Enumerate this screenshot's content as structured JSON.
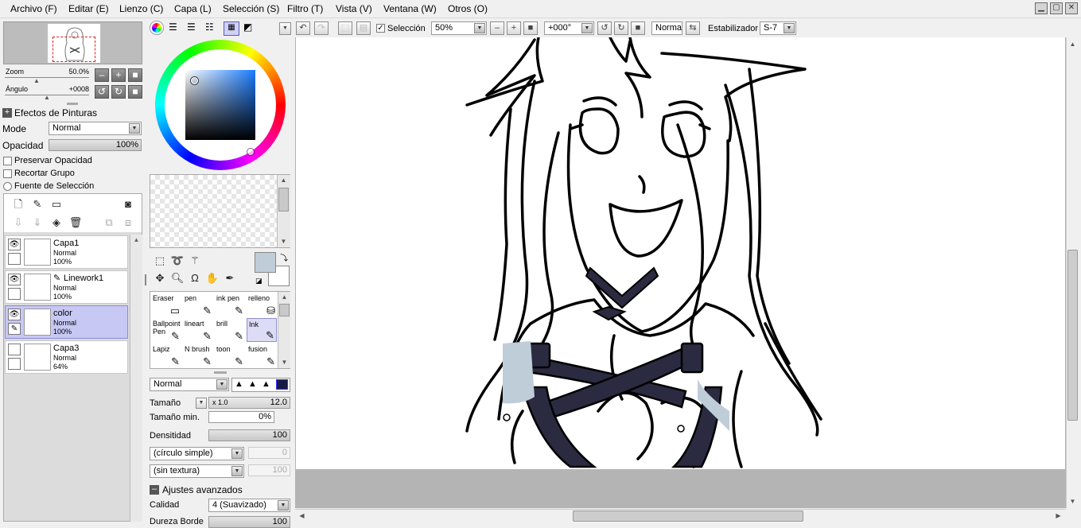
{
  "menu": [
    "Archivo (F)",
    "Editar (E)",
    "Lienzo (C)",
    "Capa (L)",
    "Selección (S)",
    "Filtro (T)",
    "Vista (V)",
    "Ventana (W)",
    "Otros (O)"
  ],
  "navigator": {
    "zoom_label": "Zoom",
    "zoom_value": "50.0%",
    "angle_label": "Ángulo",
    "angle_value": "+0008"
  },
  "paint_effects": {
    "header": "Efectos de Pinturas",
    "mode_label": "Mode",
    "mode_value": "Normal",
    "opacity_label": "Opacidad",
    "opacity_value": "100%",
    "opacity_fill": 1.0,
    "preserve_opacity": "Preservar Opacidad",
    "clip_group": "Recortar Grupo",
    "selection_source": "Fuente de Selección"
  },
  "layers": [
    {
      "name": "Capa1",
      "mode": "Normal",
      "opacity": "100%",
      "selected": false,
      "eye": true,
      "icon": ""
    },
    {
      "name": "Linework1",
      "mode": "Normal",
      "opacity": "100%",
      "selected": false,
      "eye": true,
      "icon": "✎"
    },
    {
      "name": "color",
      "mode": "Normal",
      "opacity": "100%",
      "selected": true,
      "eye": true,
      "icon": ""
    },
    {
      "name": "Capa3",
      "mode": "Normal",
      "opacity": "64%",
      "selected": false,
      "eye": false,
      "icon": ""
    }
  ],
  "colors": {
    "primary": "#bfcdd8",
    "secondary": "#ffffff",
    "square_hue": "#1a7cff"
  },
  "brushes": [
    {
      "name": "Eraser",
      "icon": "▭"
    },
    {
      "name": "pen",
      "icon": "✎"
    },
    {
      "name": "ink pen",
      "icon": "✎"
    },
    {
      "name": "relleno",
      "icon": "⛁"
    },
    {
      "name": "Ballpoint Pen",
      "icon": "✎"
    },
    {
      "name": "lineart",
      "icon": "✎"
    },
    {
      "name": "brill",
      "icon": "✎"
    },
    {
      "name": "Ink",
      "icon": "✎"
    },
    {
      "name": "Lapiz",
      "icon": "✎"
    },
    {
      "name": "N brush",
      "icon": "✎"
    },
    {
      "name": "toon",
      "icon": "✎"
    },
    {
      "name": "fusion",
      "icon": "✎"
    }
  ],
  "selected_brush": "Ink",
  "brush_settings": {
    "blend_mode": "Normal",
    "size_label": "Tamaño",
    "size_multiplier": "x 1.0",
    "size_value": "12.0",
    "min_size_label": "Tamaño min.",
    "min_size_value": "0%",
    "density_label": "Densitidad",
    "density_value": "100",
    "shape_value": "(círculo simple)",
    "shape_amount": "0",
    "texture_value": "(sin textura)",
    "texture_amount": "100",
    "advanced_label": "Ajustes avanzados",
    "quality_label": "Calidad",
    "quality_value": "4 (Suavizado)",
    "hardness_label": "Dureza Borde",
    "hardness_value": "100"
  },
  "toolbar": {
    "selection_label": "Selección",
    "selection_checked": true,
    "zoom_value": "50%",
    "angle_value": "+000°",
    "blend_value": "Normal",
    "stabilizer_label": "Estabilizador",
    "stabilizer_value": "S-7"
  }
}
